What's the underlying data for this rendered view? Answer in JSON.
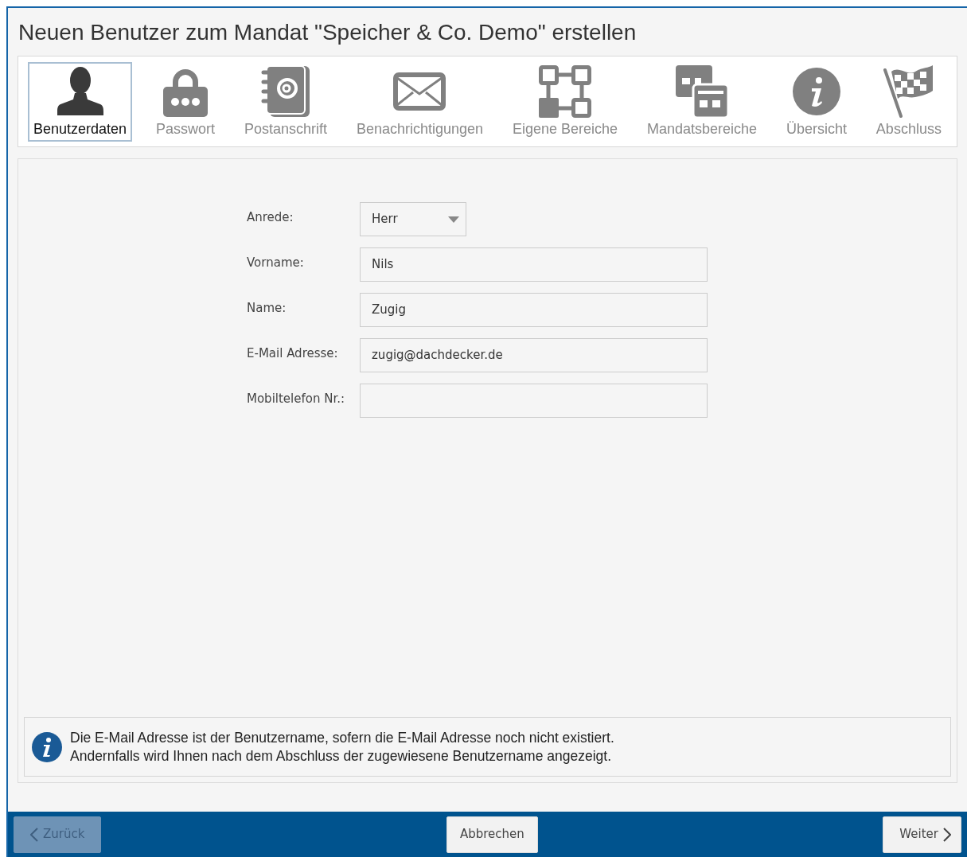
{
  "window": {
    "title": "Neuen Benutzer zum Mandat \"Speicher & Co. Demo\" erstellen"
  },
  "steps": [
    {
      "label": "Benutzerdaten",
      "kind": "user",
      "selected": true
    },
    {
      "label": "Passwort",
      "kind": "lock",
      "selected": false
    },
    {
      "label": "Postanschrift",
      "kind": "address-book",
      "selected": false
    },
    {
      "label": "Benachrichtigungen",
      "kind": "envelope",
      "selected": false
    },
    {
      "label": "Eigene Bereiche",
      "kind": "network",
      "selected": false
    },
    {
      "label": "Mandatsbereiche",
      "kind": "windows",
      "selected": false
    },
    {
      "label": "Übersicht",
      "kind": "info",
      "selected": false
    },
    {
      "label": "Abschluss",
      "kind": "flag",
      "selected": false
    }
  ],
  "form": [
    {
      "label": "Anrede:",
      "kind": "select",
      "value": "Herr"
    },
    {
      "label": "Vorname:",
      "kind": "text",
      "value": "Nils"
    },
    {
      "label": "Name:",
      "kind": "text",
      "value": "Zugig"
    },
    {
      "label": "E-Mail Adresse:",
      "kind": "text",
      "value": "zugig@dachdecker.de"
    },
    {
      "label": "Mobiltelefon Nr.:",
      "kind": "text"
    }
  ],
  "info": {
    "lines": [
      "Die E-Mail Adresse ist der Benutzername, sofern die E-Mail Adresse noch nicht existiert.",
      "Andernfalls wird Ihnen nach dem Abschluss der zugewiesene Benutzername angezeigt."
    ]
  },
  "footer": {
    "back": {
      "label": "Zurück",
      "disabled": true
    },
    "cancel": {
      "label": "Abbrechen"
    },
    "next": {
      "label": "Weiter",
      "disabled": false
    }
  }
}
